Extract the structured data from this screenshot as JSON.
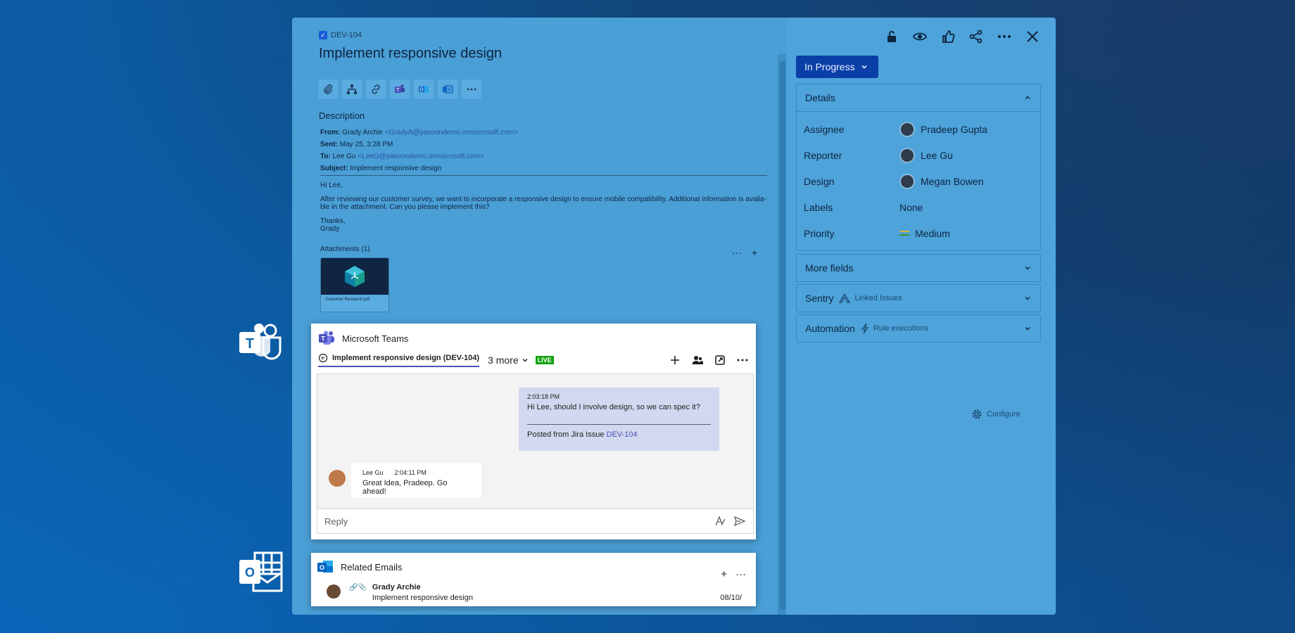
{
  "issue": {
    "key": "DEV-104",
    "title": "Implement responsive design",
    "description_heading": "Description"
  },
  "email": {
    "from_label": "From:",
    "from_name": "Grady Archie",
    "from_addr": "<GradyA@yasoondemo.onmicrosoft.com>",
    "sent_label": "Sent:",
    "sent_value": "May 25, 3:28 PM",
    "to_label": "To:",
    "to_name": "Lee Gu",
    "to_addr": "<LeeG@yasoondemo.onmicrosoft.com>",
    "subject_label": "Subject:",
    "subject_value": "Implement responsive design",
    "greeting": "Hi Lee,",
    "body": "After reviewing our customer survey, we want to incorporate a responsive design to ensure mobile compatibility. Additional information is availa-ble in the attachment. Can you please implement this?",
    "closing_1": "Thanks,",
    "closing_2": "Grady"
  },
  "attachments": {
    "label": "Attachments (1)",
    "file_name": "Customer Research.pdf"
  },
  "status": {
    "label": "In Progress"
  },
  "details": {
    "heading": "Details",
    "rows": [
      {
        "key": "Assignee",
        "value": "Pradeep Gupta"
      },
      {
        "key": "Reporter",
        "value": "Lee Gu"
      },
      {
        "key": "Design",
        "value": "Megan Bowen"
      },
      {
        "key": "Labels",
        "value": "None"
      },
      {
        "key": "Priority",
        "value": "Medium"
      }
    ]
  },
  "panels": {
    "more_fields": "More fields",
    "sentry": "Sentry",
    "sentry_sub": "Linked Issues",
    "automation": "Automation",
    "automation_sub": "Rule executions",
    "configure": "Configure"
  },
  "teams": {
    "title": "Microsoft Teams",
    "active_tab": "Implement responsive design (DEV-104)",
    "more_tabs": "3 more",
    "live": "LIVE",
    "my_msg_time": "2:03:18 PM",
    "my_msg_text": "Hi Lee, should I involve design, so we can spec it?",
    "posted_from": "Posted from Jira Issue",
    "posted_link": "DEV-104",
    "other_name": "Lee Gu",
    "other_time": "2:04:11 PM",
    "other_text": "Great Idea, Pradeep. Go ahead!",
    "reply_placeholder": "Reply"
  },
  "related_emails": {
    "title": "Related Emails",
    "sender": "Grady Archie",
    "subject": "Implement responsive design",
    "date": "08/10/"
  },
  "colors": {
    "dialog_bg": "#4a9fd6",
    "status_blue": "#0b3fa8",
    "teams_purple": "#4b53bc",
    "live_green": "#13a10e"
  }
}
